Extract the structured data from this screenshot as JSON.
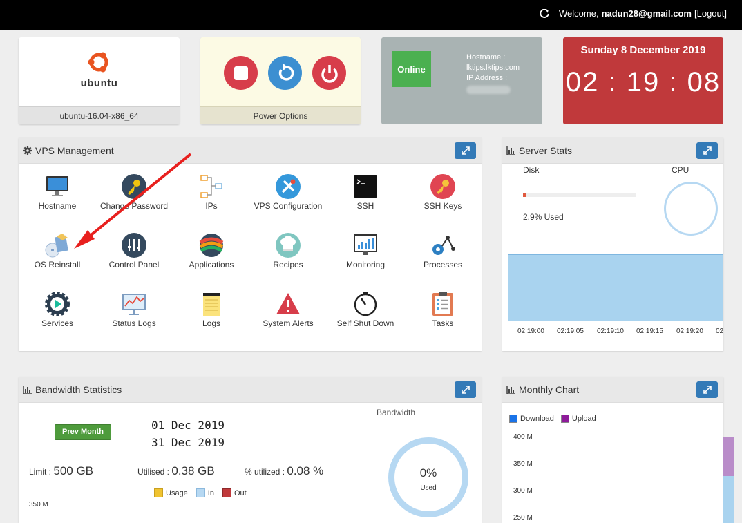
{
  "topbar": {
    "welcome_prefix": "Welcome,",
    "email": "nadun28@gmail.com",
    "logout": "[Logout]"
  },
  "os_card": {
    "logo_text": "ubuntu",
    "os_name": "ubuntu-16.04-x86_64"
  },
  "power_card": {
    "footer": "Power Options"
  },
  "status_card": {
    "status": "Online",
    "hostname_label": "Hostname :",
    "hostname": "lktips.lktips.com",
    "ip_label": "IP Address :"
  },
  "clock": {
    "date": "Sunday 8 December 2019",
    "time": "02 : 19 : 08"
  },
  "vps": {
    "title": "VPS Management",
    "tiles": [
      {
        "label": "Hostname"
      },
      {
        "label": "Change Password"
      },
      {
        "label": "IPs"
      },
      {
        "label": "VPS Configuration"
      },
      {
        "label": "SSH"
      },
      {
        "label": "SSH Keys"
      },
      {
        "label": "OS Reinstall"
      },
      {
        "label": "Control Panel"
      },
      {
        "label": "Applications"
      },
      {
        "label": "Recipes"
      },
      {
        "label": "Monitoring"
      },
      {
        "label": "Processes"
      },
      {
        "label": "Services"
      },
      {
        "label": "Status Logs"
      },
      {
        "label": "Logs"
      },
      {
        "label": "System Alerts"
      },
      {
        "label": "Self Shut Down"
      },
      {
        "label": "Tasks"
      }
    ]
  },
  "server_stats": {
    "title": "Server Stats",
    "disk_label": "Disk",
    "cpu_label": "CPU",
    "disk_used_text": "2.9% Used",
    "disk_used_fraction": 0.029,
    "times": [
      "02:19:00",
      "02:19:05",
      "02:19:10",
      "02:19:15",
      "02:19:20",
      "02"
    ]
  },
  "bandwidth": {
    "title": "Bandwidth Statistics",
    "prev_month": "Prev Month",
    "start_date": "01 Dec 2019",
    "end_date": "31 Dec 2019",
    "chart_title": "Bandwidth",
    "limit_label": "Limit :",
    "limit_value": "500 GB",
    "utilised_label": "Utilised :",
    "utilised_value": "0.38 GB",
    "pct_label": "% utilized :",
    "pct_value": "0.08 %",
    "legend": [
      {
        "label": "Usage",
        "color": "#f0c330"
      },
      {
        "label": "In",
        "color": "#b6d8f2"
      },
      {
        "label": "Out",
        "color": "#c0393b"
      }
    ],
    "y_tick": "350 M",
    "ring_value": "0%",
    "ring_label": "Used"
  },
  "monthly": {
    "title": "Monthly Chart",
    "legend": [
      {
        "label": "Download",
        "color": "#1a73e8"
      },
      {
        "label": "Upload",
        "color": "#8e1b9a"
      }
    ],
    "y_ticks": [
      "400 M",
      "350 M",
      "300 M",
      "250 M"
    ]
  },
  "colors": {
    "accent": "#337ab7",
    "danger": "#c0393b",
    "success": "#4bb050"
  }
}
